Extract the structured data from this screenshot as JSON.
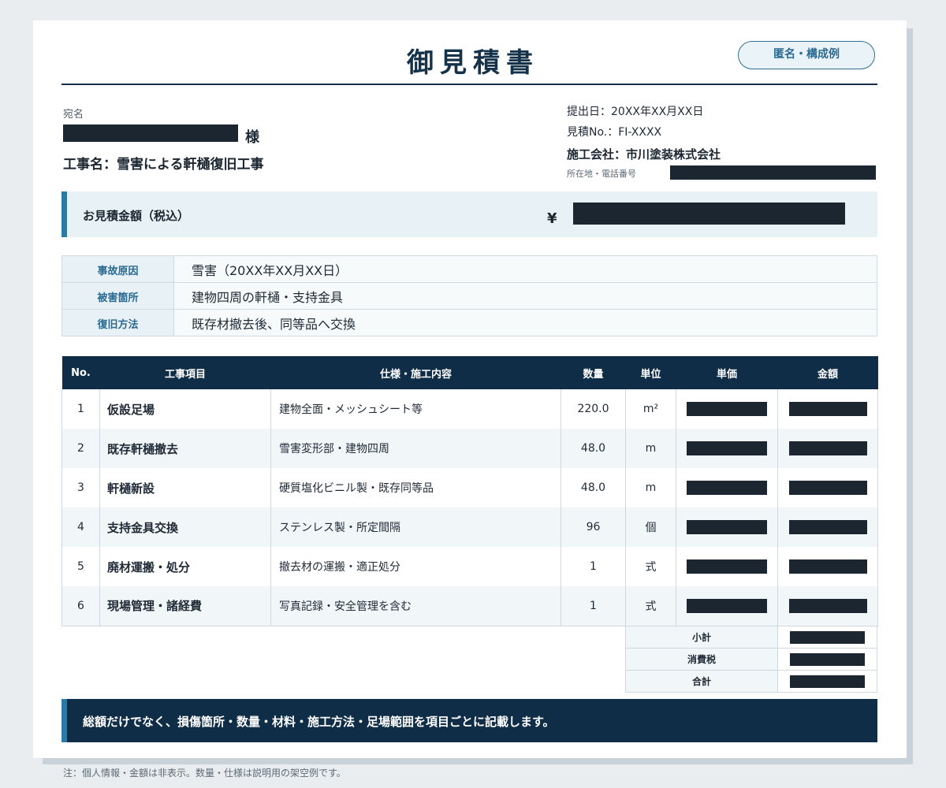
{
  "document": {
    "title": "御見積書",
    "badge": "匿名・構成例",
    "recipient_label": "宛名",
    "recipient_honorific": "様",
    "project": "工事名：雪害による軒樋復旧工事"
  },
  "meta": {
    "submit_date": "提出日：20XX年XX月XX日",
    "estimate_no": "見積No.：FI-XXXX",
    "company": "施工会社：市川塗装株式会社",
    "address_label": "所在地・電話番号"
  },
  "total": {
    "label": "お見積金額（税込）",
    "currency": "¥"
  },
  "info": [
    {
      "key": "事故原因",
      "value": "雪害（20XX年XX月XX日）"
    },
    {
      "key": "被害箇所",
      "value": "建物四周の軒樋・支持金具"
    },
    {
      "key": "復旧方法",
      "value": "既存材撤去後、同等品へ交換"
    }
  ],
  "table": {
    "headers": [
      "No.",
      "工事項目",
      "仕様・施工内容",
      "数量",
      "単位",
      "単価",
      "金額"
    ],
    "rows": [
      {
        "no": "1",
        "item": "仮設足場",
        "spec": "建物全面・メッシュシート等",
        "qty": "220.0",
        "unit": "m²"
      },
      {
        "no": "2",
        "item": "既存軒樋撤去",
        "spec": "雪害変形部・建物四周",
        "qty": "48.0",
        "unit": "m"
      },
      {
        "no": "3",
        "item": "軒樋新設",
        "spec": "硬質塩化ビニル製・既存同等品",
        "qty": "48.0",
        "unit": "m"
      },
      {
        "no": "4",
        "item": "支持金具交換",
        "spec": "ステンレス製・所定間隔",
        "qty": "96",
        "unit": "個"
      },
      {
        "no": "5",
        "item": "廃材運搬・処分",
        "spec": "撤去材の運搬・適正処分",
        "qty": "1",
        "unit": "式"
      },
      {
        "no": "6",
        "item": "現場管理・諸経費",
        "spec": "写真記録・安全管理を含む",
        "qty": "1",
        "unit": "式"
      }
    ]
  },
  "summary": {
    "subtotal": "小計",
    "tax": "消費税",
    "total": "合計"
  },
  "note": "総額だけでなく、損傷箇所・数量・材料・施工方法・足場範囲を項目ごとに記載します。",
  "footnote": "注：個人情報・金額は非表示。数量・仕様は説明用の架空例です。"
}
